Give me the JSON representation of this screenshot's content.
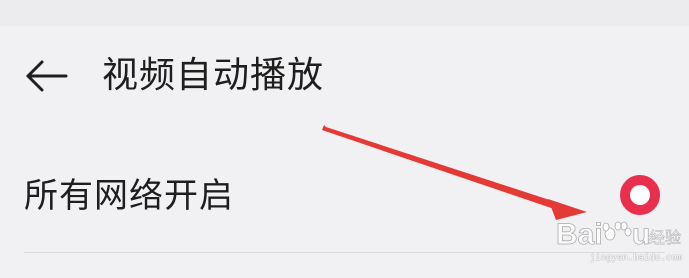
{
  "header": {
    "back_icon": "arrow-left-icon",
    "title": "视频自动播放"
  },
  "setting": {
    "label": "所有网络开启",
    "selected": true,
    "accent_color": "#ea2f4e"
  },
  "annotation": {
    "arrow_color": "#e53935"
  },
  "watermark": {
    "logo_text": "Baidu经验",
    "sub_text": "jingyan.baidu.com"
  }
}
